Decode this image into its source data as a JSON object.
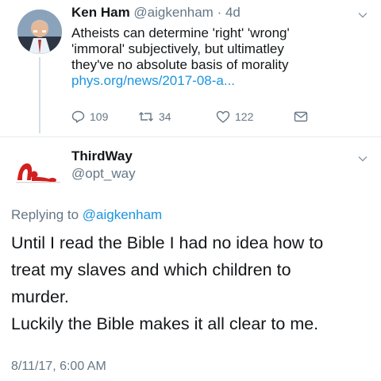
{
  "tweet1": {
    "author_name": "Ken Ham",
    "author_handle": "@aigkenham",
    "time": "4d",
    "separator": " · ",
    "text_lines": [
      "Atheists can determine 'right' 'wrong'",
      "'immoral' subjectively, but ultimatley",
      "they've no absolute basis of morality"
    ],
    "link": "phys.org/news/2017-08-a...",
    "actions": {
      "reply_count": "109",
      "retweet_count": "34",
      "like_count": "122"
    },
    "icons": [
      "reply-icon",
      "retweet-icon",
      "like-icon",
      "message-icon",
      "chevron-down-icon"
    ]
  },
  "tweet2": {
    "author_name": "ThirdWay",
    "author_handle": "@opt_way",
    "replying_prefix": "Replying to ",
    "replying_to": "@aigkenham",
    "text_lines": [
      "Until I read the Bible I had no idea how to",
      "treat my slaves and which children to",
      "murder.",
      "Luckily the Bible makes it all clear to me."
    ],
    "timestamp": "8/11/17, 6:00 AM"
  },
  "colors": {
    "link": "#1b95e0",
    "secondary_text": "#657786",
    "primary_text": "#14171a",
    "divider": "#e6ecf0",
    "avatar_accent": "#d21f1f"
  }
}
